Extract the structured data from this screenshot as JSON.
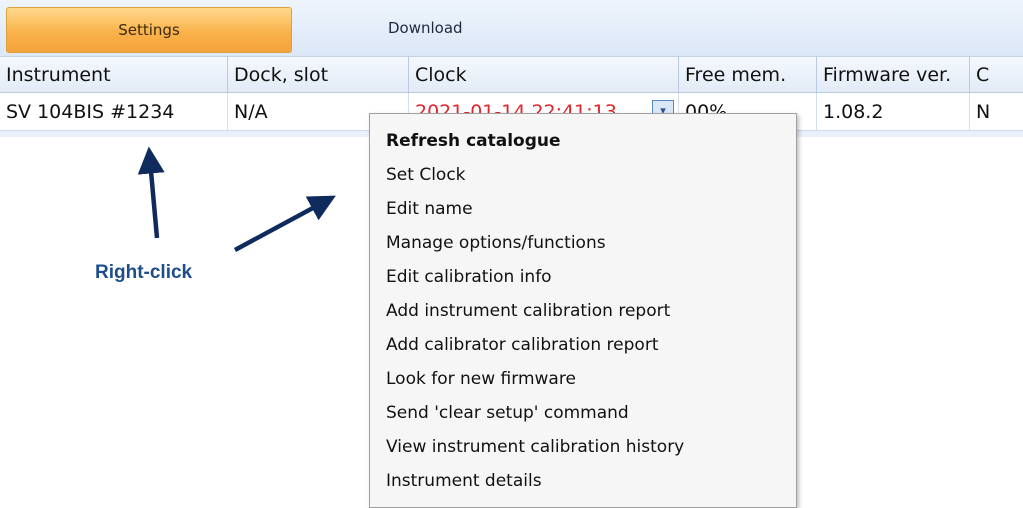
{
  "tabs": {
    "settings": "Settings",
    "download": "Download"
  },
  "columns": [
    "Instrument",
    "Dock, slot",
    "Clock",
    "Free mem.",
    "Firmware ver.",
    "C"
  ],
  "row": {
    "instrument": "SV 104BIS #1234",
    "dock_slot": "N/A",
    "clock": "2021-01-14 22:41:13",
    "free_mem": "00%",
    "firmware": "1.08.2",
    "last": "N"
  },
  "context_menu": {
    "items": [
      "Refresh catalogue",
      "Set Clock",
      "Edit name",
      "Manage options/functions",
      "Edit calibration info",
      "Add instrument calibration report",
      "Add calibrator calibration report",
      "Look for new firmware",
      "Send 'clear setup' command",
      "View instrument calibration history",
      "Instrument details"
    ]
  },
  "annotation": {
    "label": "Right-click"
  },
  "colors": {
    "tab_active": "#f9b24a",
    "clock_text": "#e0262c",
    "annotation": "#1f4e8c"
  },
  "icons": {
    "clock_dropdown": "chevron-down-icon"
  }
}
